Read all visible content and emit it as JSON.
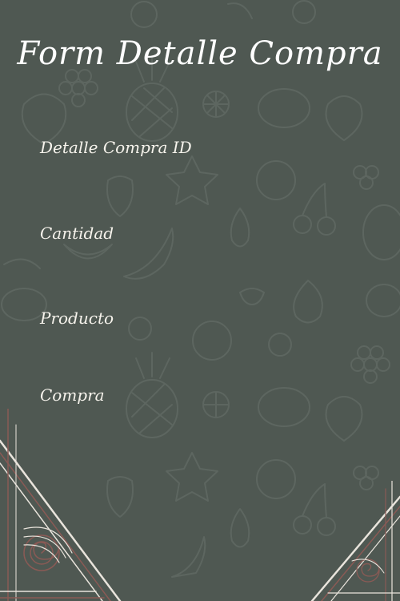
{
  "form": {
    "title": "Form Detalle Compra",
    "fields": [
      {
        "label": "Detalle Compra ID",
        "value": ""
      },
      {
        "label": "Cantidad",
        "value": ""
      },
      {
        "label": "Producto",
        "value": ""
      },
      {
        "label": "Compra",
        "value": ""
      }
    ]
  },
  "theme": {
    "background": "#4f5852",
    "pattern_stroke": "#5d6660",
    "text": "#f6f3ec",
    "ornament_white": "#e9e4dc",
    "ornament_red": "#8a5a55"
  }
}
